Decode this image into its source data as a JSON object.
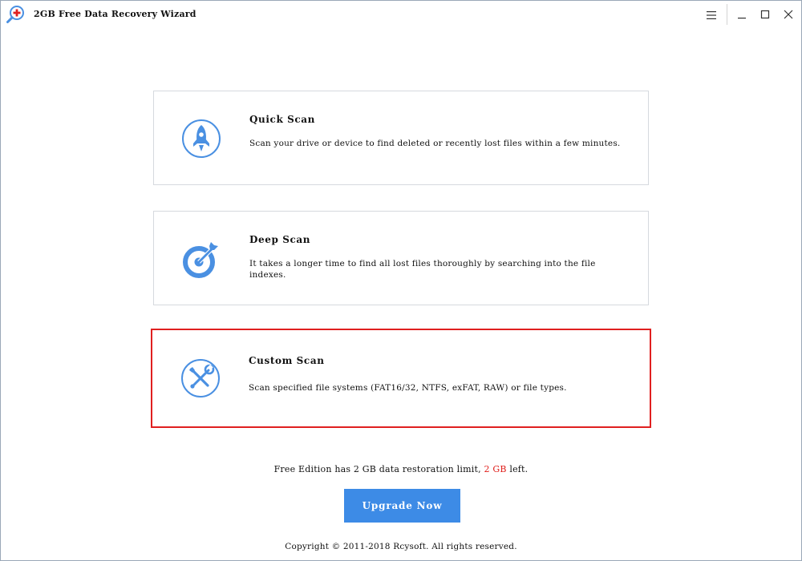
{
  "window": {
    "title": "2GB Free Data Recovery Wizard"
  },
  "controls": {
    "menu": "menu-icon",
    "minimize": "minimize-icon",
    "maximize": "maximize-icon",
    "close": "close-icon"
  },
  "colors": {
    "accent": "#3d8be6",
    "icon_blue": "#4a90e2",
    "selection_border": "#e02020",
    "limit_highlight": "#e0201c"
  },
  "scan_options": [
    {
      "icon": "rocket-icon",
      "title": "Quick Scan",
      "description": "Scan your drive or device to find deleted or recently lost files within a few minutes.",
      "selected": false
    },
    {
      "icon": "target-icon",
      "title": "Deep Scan",
      "description": "It takes a longer time to find all lost files thoroughly by searching into the file indexes.",
      "selected": false
    },
    {
      "icon": "tools-icon",
      "title": "Custom Scan",
      "description": "Scan specified file systems (FAT16/32, NTFS, exFAT, RAW) or file types.",
      "selected": true
    }
  ],
  "footer": {
    "limit_prefix": "Free Edition has 2 GB data restoration limit,",
    "limit_value": "2 GB",
    "limit_suffix": "left.",
    "upgrade_label": "Upgrade Now",
    "copyright": "Copyright © 2011-2018 Rcysoft. All rights reserved."
  }
}
